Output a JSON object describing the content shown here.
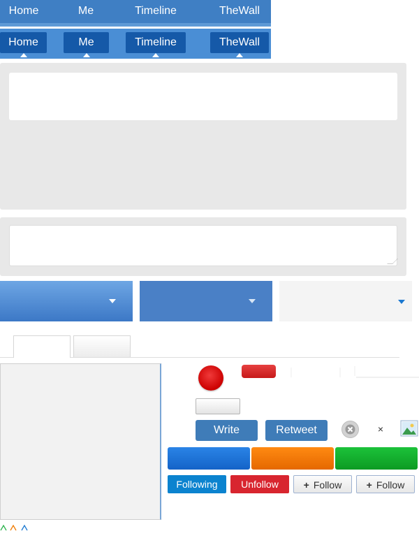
{
  "nav_primary": {
    "items": [
      "Home",
      "Me",
      "Timeline",
      "TheWall"
    ]
  },
  "nav_secondary": {
    "items": [
      "Home",
      "Me",
      "Timeline",
      "TheWall"
    ]
  },
  "actions": {
    "write_label": "Write",
    "retweet_label": "Retweet",
    "close_glyph": "×",
    "following_label": "Following",
    "unfollow_label": "Unfollow",
    "follow_label": "Follow",
    "plus_glyph": "+"
  },
  "colors": {
    "nav_blue": "#3f7fc4",
    "nav_dark": "#1559a8",
    "red": "#cc0000",
    "orange": "#f07a00",
    "green": "#12b02c",
    "following": "#0b83cf",
    "unfollow": "#d8252f"
  },
  "icons": [
    "dropdown-caret-icon",
    "close-circle-icon",
    "close-icon",
    "image-icon",
    "plus-icon"
  ]
}
